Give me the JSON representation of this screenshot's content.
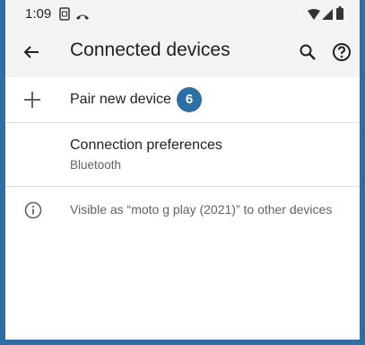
{
  "status_bar": {
    "time": "1:09",
    "icons": [
      "screenshot-icon",
      "call-icon",
      "wifi-icon",
      "signal-icon",
      "battery-icon"
    ]
  },
  "app_bar": {
    "title": "Connected devices",
    "back_icon": "back-arrow-icon",
    "search_icon": "search-icon",
    "help_icon": "help-icon"
  },
  "list": {
    "pair": {
      "label": "Pair new device",
      "icon": "plus-icon",
      "badge": "6"
    },
    "preferences": {
      "label": "Connection preferences",
      "summary": "Bluetooth"
    },
    "info": {
      "icon": "info-icon",
      "text": "Visible as “moto g play (2021)” to other devices"
    }
  },
  "colors": {
    "frame": "#2f6ea5",
    "badge": "#2f6ea5",
    "header_bg": "#f3f3f3",
    "divider": "#dcdcdc"
  }
}
